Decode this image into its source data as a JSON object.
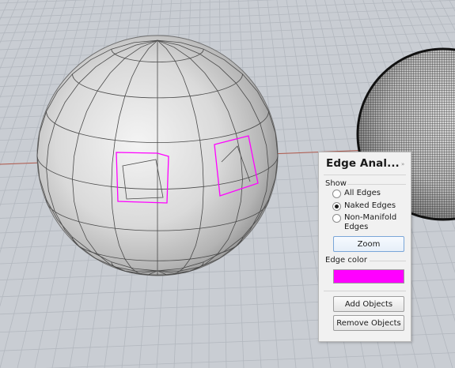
{
  "panel": {
    "title": "Edge Anal...",
    "close_glyph": "»",
    "show_label": "Show",
    "options": [
      {
        "label": "All Edges",
        "checked": false
      },
      {
        "label": "Naked Edges",
        "checked": true
      },
      {
        "label": "Non-Manifold Edges",
        "checked": false
      }
    ],
    "zoom_label": "Zoom",
    "edge_color_label": "Edge color",
    "edge_color": "#ff00ff",
    "add_objects_label": "Add Objects",
    "remove_objects_label": "Remove Objects"
  },
  "viewport": {
    "background_color": "#c9cdd3",
    "grid_color": "#b3b8bf",
    "axis_color": "#b25a4c",
    "naked_edge_color": "#ff00ff"
  }
}
